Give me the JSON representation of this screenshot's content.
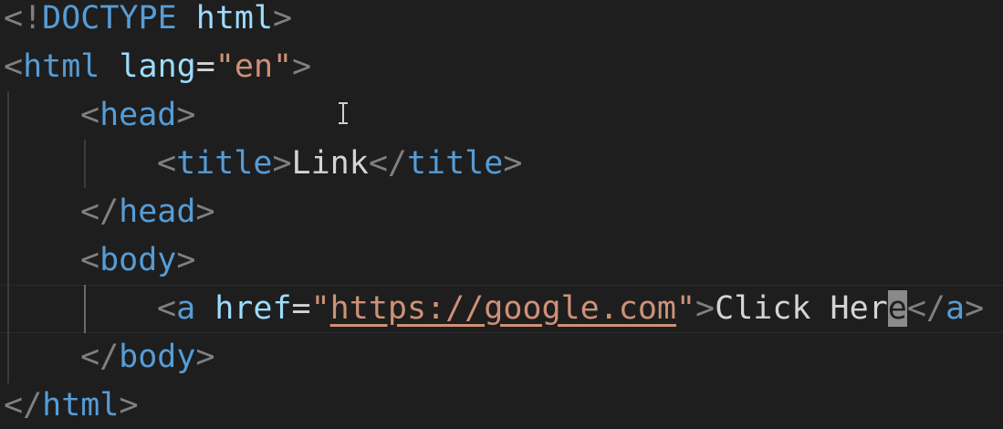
{
  "lines": [
    {
      "parts": [
        "<!",
        "DOCTYPE",
        " html",
        ">"
      ]
    },
    {
      "parts": [
        "<",
        "html",
        " lang",
        "=",
        "\"en\"",
        ">"
      ]
    },
    {
      "parts": [
        "<",
        "head",
        ">"
      ]
    },
    {
      "parts": [
        "<",
        "title",
        ">",
        "Link",
        "</",
        "title",
        ">"
      ]
    },
    {
      "parts": [
        "</",
        "head",
        ">"
      ]
    },
    {
      "parts": [
        "<",
        "body",
        ">"
      ]
    },
    {
      "parts": [
        "<",
        "a",
        " href",
        "=",
        "\"",
        "https://google.com",
        "\"",
        ">",
        "Click Her",
        "e",
        "</",
        "a",
        ">"
      ]
    },
    {
      "parts": [
        "</",
        "body",
        ">"
      ]
    },
    {
      "parts": [
        "</",
        "html",
        ">"
      ]
    }
  ]
}
